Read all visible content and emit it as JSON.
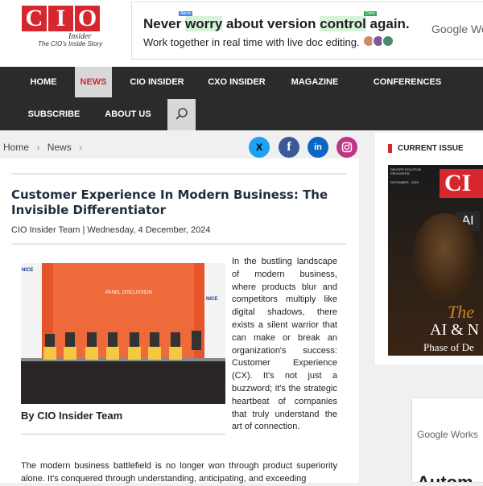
{
  "logo": {
    "letters": [
      "C",
      "I",
      "O"
    ],
    "insider": "Insider",
    "tagline": "The CIO's Inside Story"
  },
  "ad": {
    "headline_pre": "Never ",
    "headline_hl1": "worry",
    "headline_mid": " about version ",
    "headline_hl2": "control",
    "headline_post": " again.",
    "tag_left": "Alexis",
    "tag_right": "Chris",
    "subline": "Work together in real time with live doc editing.",
    "brand": "Google Work"
  },
  "nav": {
    "items": [
      "HOME",
      "NEWS",
      "CIO INSIDER",
      "CXO INSIDER",
      "MAGAZINE",
      "CONFERENCES",
      "SUBSCRIBE",
      "ABOUT US"
    ],
    "active": "NEWS"
  },
  "breadcrumb": {
    "home": "Home",
    "section": "News"
  },
  "social": [
    "X",
    "f",
    "in",
    "ig"
  ],
  "article": {
    "title": "Customer Experience In Modern Business: The Invisible Differentiator",
    "byline": "CIO Insider Team | Wednesday, 4 December, 2024",
    "caption": "By CIO Insider Team",
    "para1": "In the bustling landscape of modern business, where products blur and competitors multiply like digital shadows, there exists a silent warrior that can make or break an organization's success: Customer Experience (CX). It's not just a buzzword; it's the strategic heartbeat of companies that truly understand the art of connection.",
    "para2": "The modern business battlefield is no longer won through product superiority alone. It's conquered through understanding, anticipating, and exceeding"
  },
  "photo": {
    "banner": "PANEL DISCUSSION",
    "side_left": "NICE",
    "side_right": "NICE"
  },
  "sidebar": {
    "heading": "CURRENT ISSUE",
    "cover_logo": "CI",
    "cover_ai": "AI",
    "cover_title": "AI & N",
    "cover_sub": "Phase of De",
    "cover_small": "DEVOPS SOLUTION PROVIDERS",
    "cover_date": "DECEMBER - 2024",
    "cover_the": "The"
  },
  "sidebar_ad": {
    "brand": "Google Works",
    "text": "Autom"
  }
}
